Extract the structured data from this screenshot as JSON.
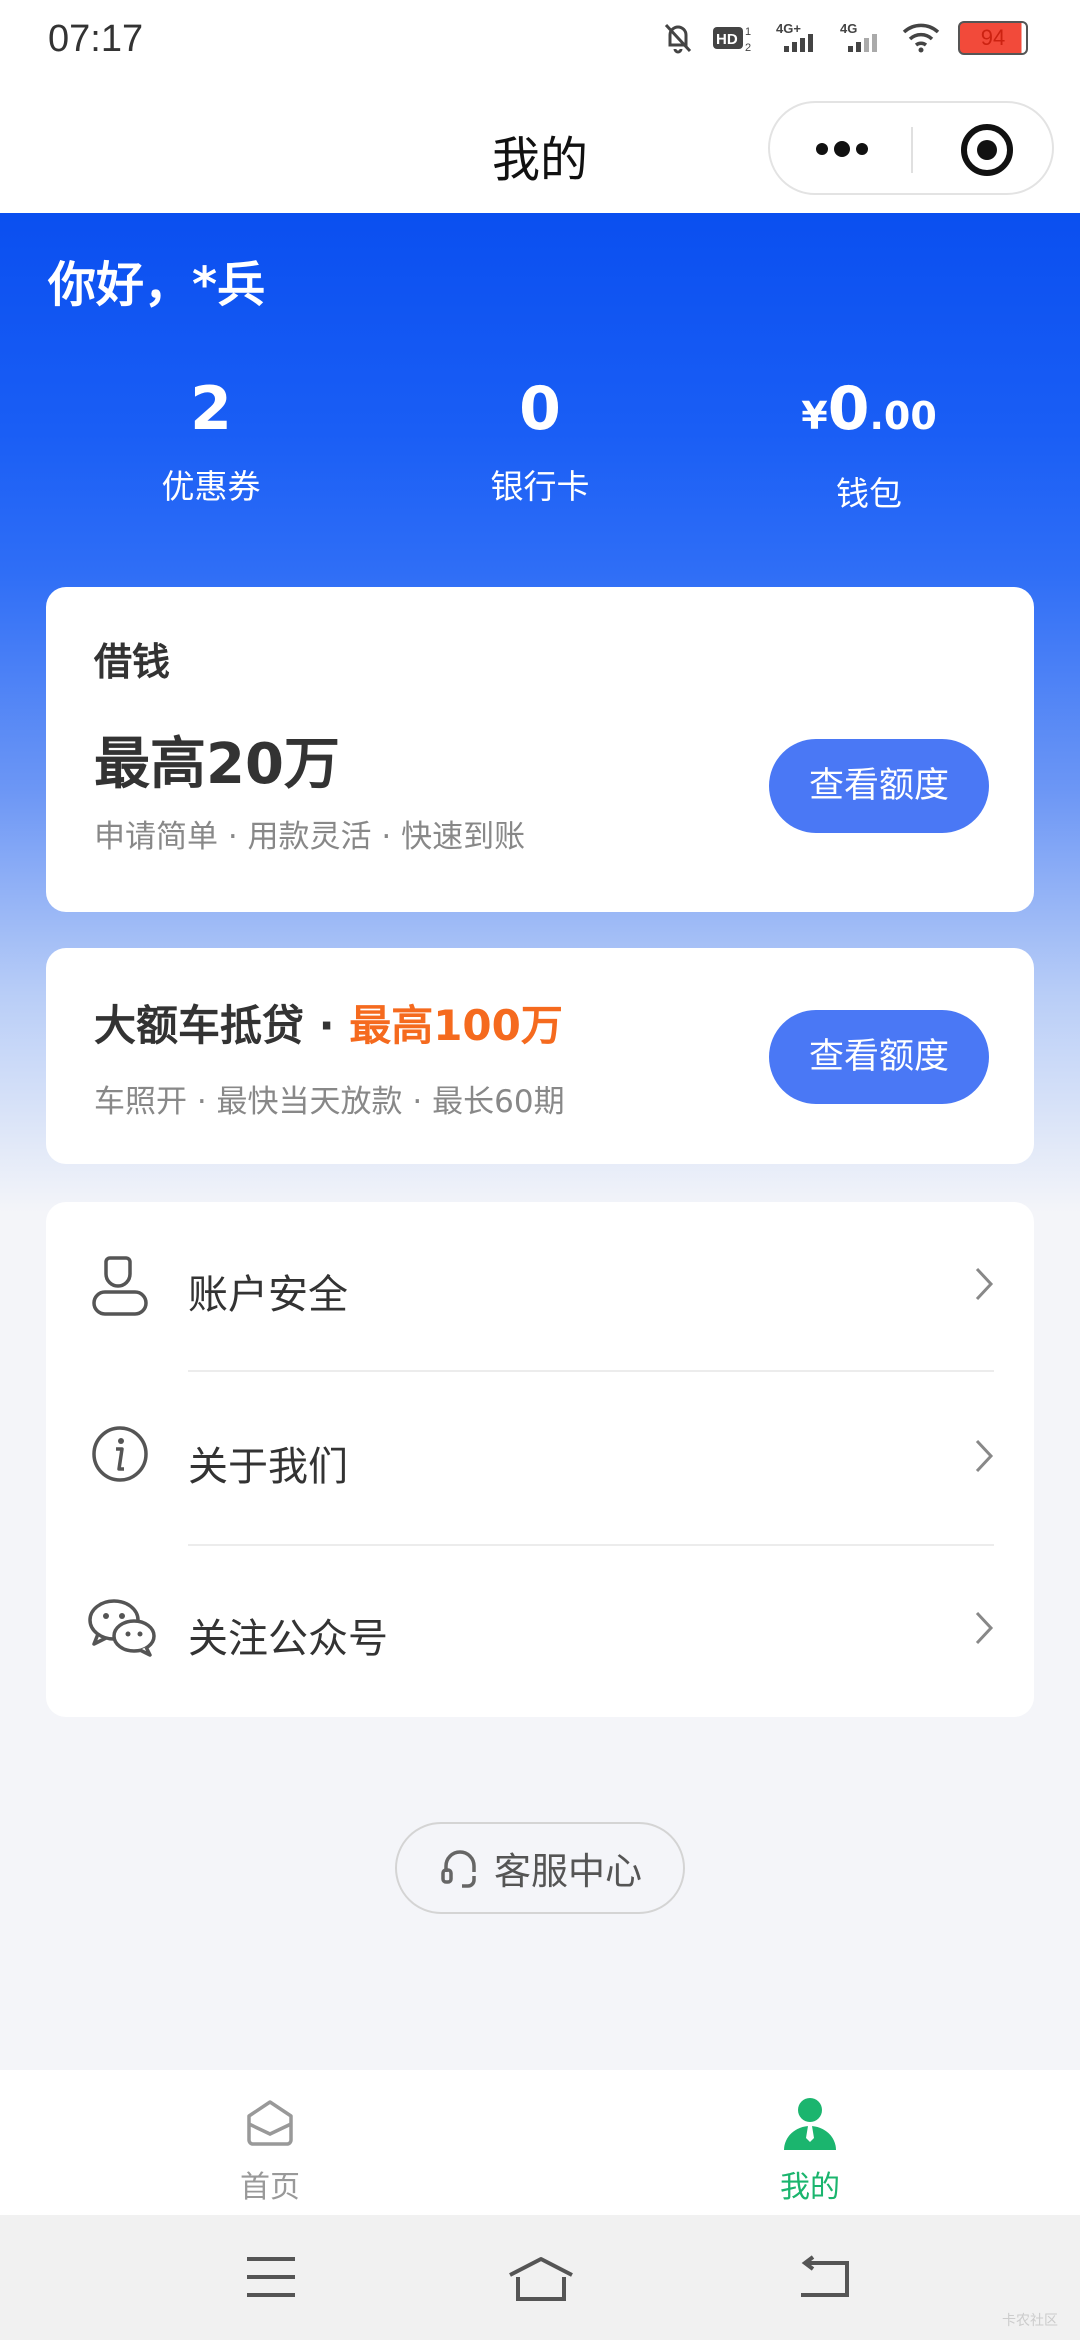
{
  "status_bar": {
    "time": "07:17",
    "battery": "94"
  },
  "nav": {
    "title": "我的"
  },
  "header": {
    "greeting": "你好，*兵",
    "stats": [
      {
        "value": "2",
        "label": "优惠券"
      },
      {
        "value": "0",
        "label": "银行卡"
      },
      {
        "currency": "¥",
        "value_int": "0",
        "value_dec": ".00",
        "label": "钱包"
      }
    ]
  },
  "loan_card": {
    "title": "借钱",
    "amount": "最高20万",
    "desc": "申请简单 · 用款灵活 · 快速到账",
    "button": "查看额度"
  },
  "car_card": {
    "title": "大额车抵贷 · ",
    "highlight": "最高100万",
    "desc": "车照开 ·  最快当天放款 · 最长60期",
    "button": "查看额度"
  },
  "menu": [
    {
      "label": "账户安全",
      "icon": "user-icon"
    },
    {
      "label": "关于我们",
      "icon": "info-icon"
    },
    {
      "label": "关注公众号",
      "icon": "wechat-icon"
    }
  ],
  "service": {
    "label": "客服中心"
  },
  "tabs": [
    {
      "label": "首页",
      "active": false
    },
    {
      "label": "我的",
      "active": true
    }
  ],
  "colors": {
    "brand_blue": "#0a4ff0",
    "button_blue": "#4a78f5",
    "highlight_orange": "#f56a1e",
    "tab_active": "#1bb56e",
    "tab_inactive": "#999999"
  },
  "watermark": "卡农社区"
}
